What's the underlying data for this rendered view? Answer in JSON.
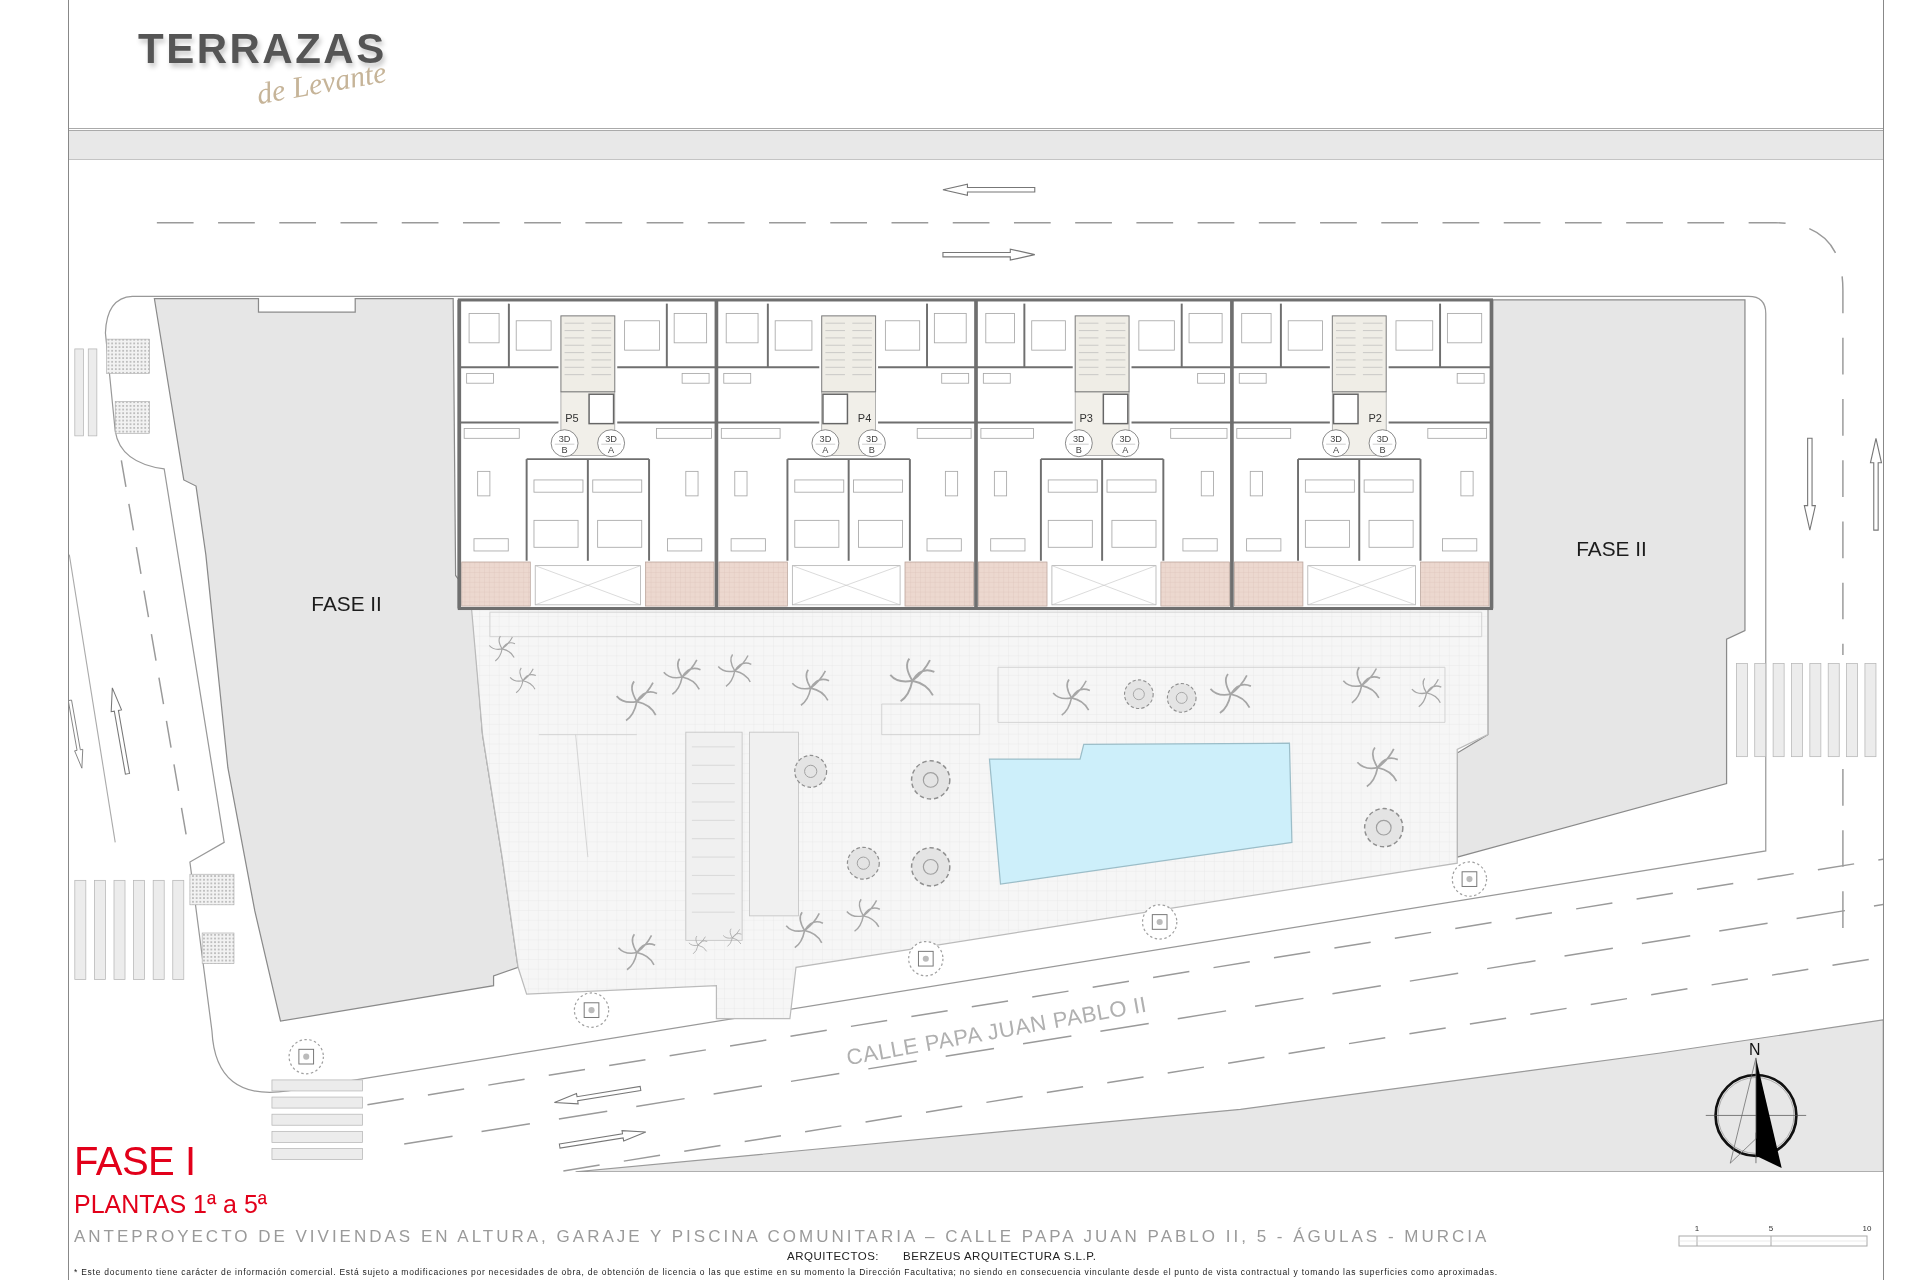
{
  "header": {
    "logo": {
      "wordmark": "TERRAZAS",
      "script": "de Levante"
    }
  },
  "site_plan": {
    "phase_blocks": [
      {
        "label": "FASE II"
      },
      {
        "label": "FASE II"
      }
    ],
    "building": {
      "cores": [
        {
          "label": "P5",
          "tags": [
            {
              "type": "3D",
              "unit": "B"
            },
            {
              "type": "3D",
              "unit": "A"
            }
          ]
        },
        {
          "label": "P4",
          "tags": [
            {
              "type": "3D",
              "unit": "A"
            },
            {
              "type": "3D",
              "unit": "B"
            }
          ]
        },
        {
          "label": "P3",
          "tags": [
            {
              "type": "3D",
              "unit": "B"
            },
            {
              "type": "3D",
              "unit": "A"
            }
          ]
        },
        {
          "label": "P2",
          "tags": [
            {
              "type": "3D",
              "unit": "A"
            },
            {
              "type": "3D",
              "unit": "B"
            }
          ]
        }
      ]
    },
    "street_name": "CALLE PAPA JUAN PABLO II",
    "compass": {
      "label": "N"
    }
  },
  "title_block": {
    "phase": "FASE I",
    "floors": "PLANTAS 1ª a 5ª",
    "project": "ANTEPROYECTO DE VIVIENDAS EN ALTURA, GARAJE Y PISCINA COMUNITARIA – CALLE PAPA JUAN PABLO II, 5 - ÁGULAS - MURCIA",
    "architects_label": "ARQUITECTOS:",
    "architects": "BERZEUS ARQUITECTURA S.L.P.",
    "disclaimer": "* Este documento tiene carácter de información comercial. Está sujeto a modificaciones por necesidades de obra, de obtención de licencia o las que estime en su momento la Dirección Facultativa; no siendo en consecuencia vinculante desde el punto de vista contractual y tomando las superficies como aproximadas."
  },
  "scale_bar": {
    "ticks": [
      "1",
      "5",
      "10"
    ]
  }
}
